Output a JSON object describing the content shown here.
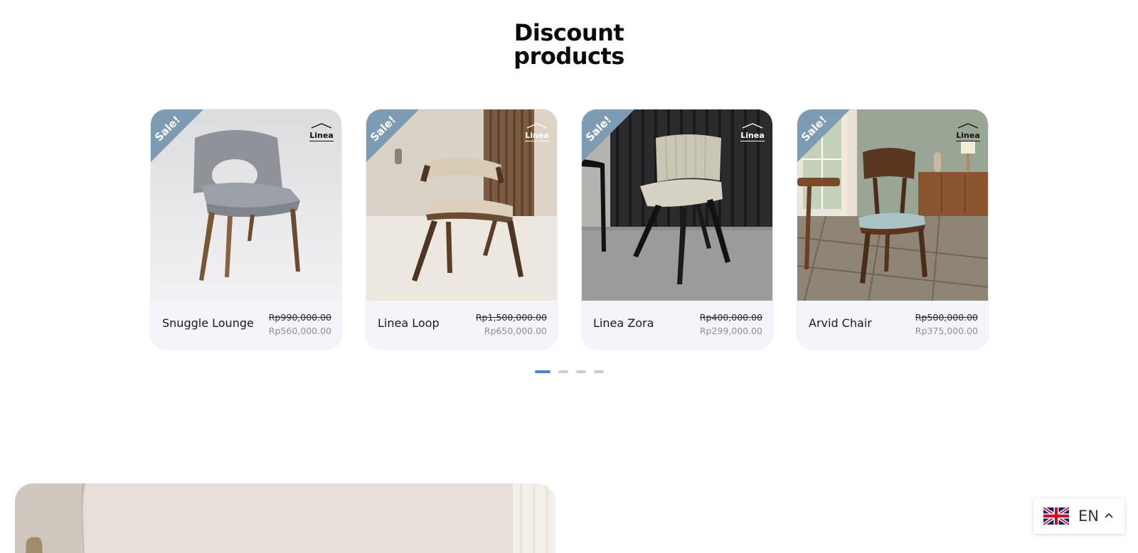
{
  "section": {
    "title_line1": "Discount",
    "title_line2": "products"
  },
  "products": [
    {
      "name": "Snuggle Lounge",
      "old_price": "Rp990,000.00",
      "new_price": "Rp560,000.00",
      "badge": "Sale!",
      "brand": "Linea"
    },
    {
      "name": "Linea Loop",
      "old_price": "Rp1,500,000.00",
      "new_price": "Rp650,000.00",
      "badge": "Sale!",
      "brand": "Linea"
    },
    {
      "name": "Linea Zora",
      "old_price": "Rp400,000.00",
      "new_price": "Rp299,000.00",
      "badge": "Sale!",
      "brand": "Linea"
    },
    {
      "name": "Arvid Chair",
      "old_price": "Rp500,000.00",
      "new_price": "Rp375,000.00",
      "badge": "Sale!",
      "brand": "Linea"
    }
  ],
  "carousel": {
    "active_page": 1,
    "page_count": 4
  },
  "language": {
    "code": "EN",
    "flag_icon": "uk-flag-icon"
  },
  "colors": {
    "sale_ribbon": "#7d9bb3",
    "active_dot": "#4a7fe0",
    "card_bg": "#f4f5fa"
  }
}
